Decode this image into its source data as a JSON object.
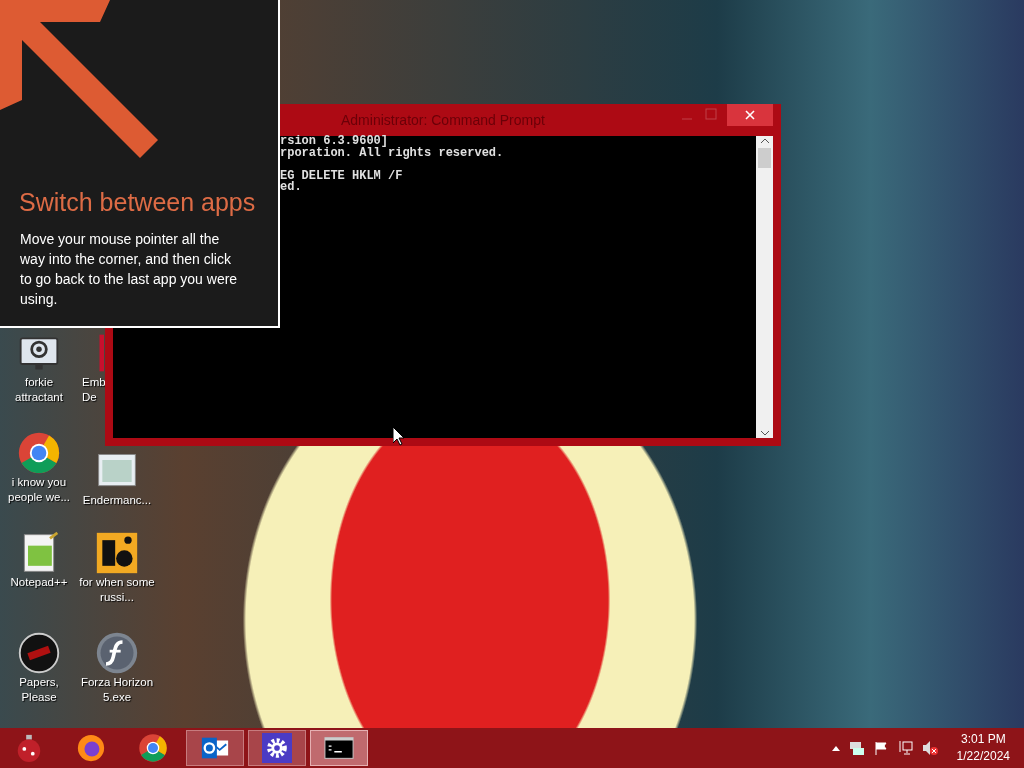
{
  "tip": {
    "title": "Switch between apps",
    "body": "Move your mouse pointer all the way into the corner, and then click to go back to the last app you were using."
  },
  "console": {
    "title": "Administrator: Command Prompt",
    "blocks": [
      [
        "rsion 6.3.9600]",
        "rporation. All rights reserved."
      ],
      [
        "EG DELETE HKLM /F",
        "ed."
      ]
    ]
  },
  "desktop_icons": [
    {
      "kind": "gear-monitor",
      "label": "forkie attractant"
    },
    {
      "kind": "chrome",
      "label": "i know you people we..."
    },
    {
      "kind": "notepad",
      "label": "Notepad++"
    },
    {
      "kind": "stamp",
      "label": "Papers, Please"
    },
    {
      "kind": "red-app",
      "label": "Emb De"
    },
    {
      "kind": "window",
      "label": "Endermanc..."
    },
    {
      "kind": "de",
      "label": "for when some russi..."
    },
    {
      "kind": "flash",
      "label": "Forza Horizon 5.exe"
    }
  ],
  "taskbar": {
    "apps": [
      {
        "kind": "ornament",
        "running": false,
        "selected": false
      },
      {
        "kind": "firefox",
        "running": false,
        "selected": false
      },
      {
        "kind": "chrome",
        "running": false,
        "selected": false
      },
      {
        "kind": "outlook",
        "running": true,
        "selected": false
      },
      {
        "kind": "settings",
        "running": true,
        "selected": false
      },
      {
        "kind": "console",
        "running": true,
        "selected": true
      }
    ],
    "clock": {
      "time": "3:01 PM",
      "date": "1/22/2024"
    }
  }
}
